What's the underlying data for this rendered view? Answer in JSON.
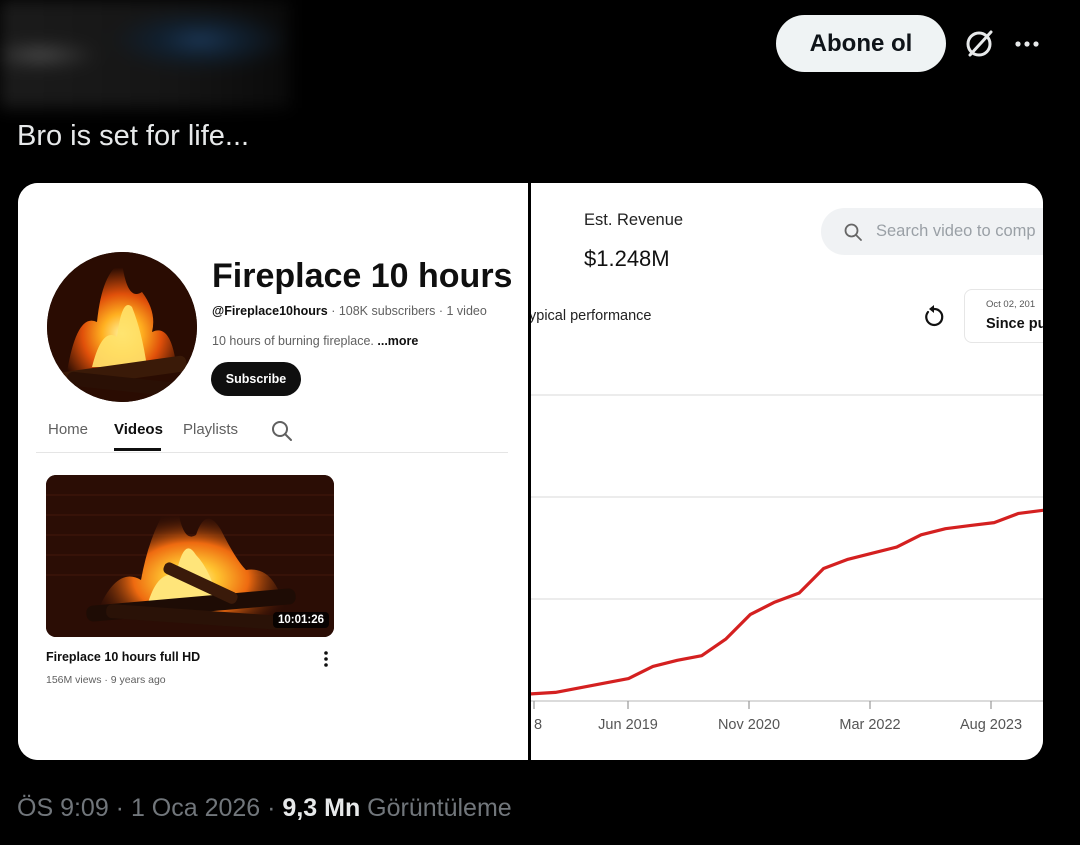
{
  "header": {
    "follow_label": "Abone ol",
    "icons": [
      "grok-icon",
      "more-icon"
    ]
  },
  "tweet": {
    "text": "Bro is set for life..."
  },
  "channel": {
    "title": "Fireplace 10 hours",
    "handle": "@Fireplace10hours",
    "stats": " · 108K subscribers · 1 video",
    "description": "10 hours of burning fireplace. ",
    "more_label": "...more",
    "subscribe_label": "Subscribe",
    "tabs": [
      {
        "label": "Home",
        "active": false
      },
      {
        "label": "Videos",
        "active": true
      },
      {
        "label": "Playlists",
        "active": false
      }
    ],
    "video": {
      "duration": "10:01:26",
      "title": "Fireplace 10 hours full HD",
      "meta": "156M views · 9 years ago"
    }
  },
  "analytics": {
    "revenue_label": "Est. Revenue",
    "revenue_value": "$1.248M",
    "search_placeholder": "Search video to comp",
    "typical_label": "ypical performance",
    "date_small": "Oct 02, 201",
    "date_big": "Since pu",
    "line_color": "#d42020"
  },
  "chart_data": {
    "type": "line",
    "xlabel": "",
    "ylabel": "",
    "x_tick_labels": [
      "8",
      "Jun 2019",
      "Nov 2020",
      "Mar 2022",
      "Aug 2023"
    ],
    "grid": true,
    "series": [
      {
        "values_normalized": [
          0.01,
          0.015,
          0.03,
          0.045,
          0.06,
          0.1,
          0.12,
          0.135,
          0.19,
          0.27,
          0.31,
          0.34,
          0.42,
          0.45,
          0.47,
          0.49,
          0.53,
          0.55,
          0.56,
          0.57,
          0.6,
          0.61
        ]
      }
    ]
  },
  "footer": {
    "timestamp": "ÖS 9:09 · 1 Oca 2026 · ",
    "views_count": "9,3 Mn",
    "views_label": " Görüntüleme"
  }
}
